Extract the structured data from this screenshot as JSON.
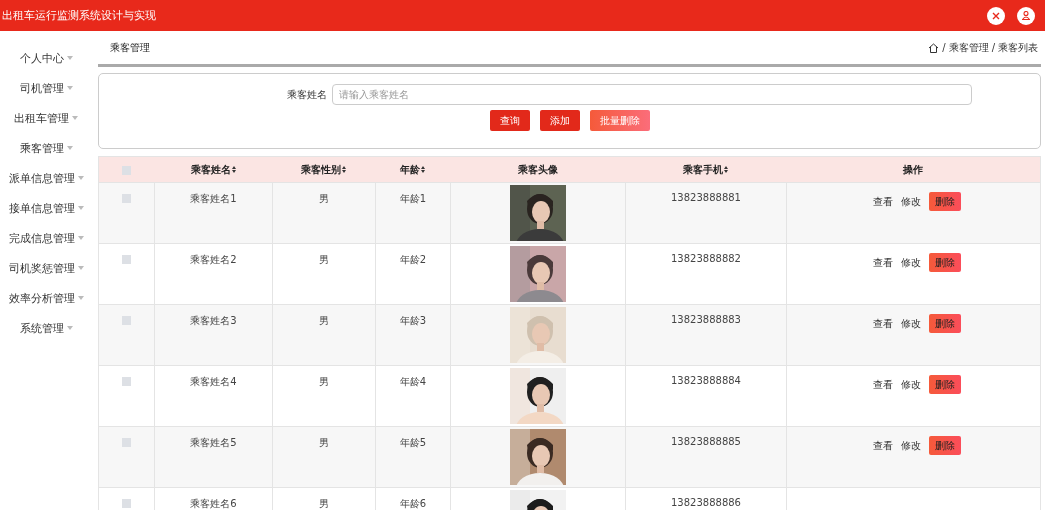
{
  "header": {
    "title": "出租车运行监测系统设计与实现"
  },
  "sidebar": {
    "items": [
      {
        "label": "个人中心"
      },
      {
        "label": "司机管理"
      },
      {
        "label": "出租车管理"
      },
      {
        "label": "乘客管理"
      },
      {
        "label": "派单信息管理"
      },
      {
        "label": "接单信息管理"
      },
      {
        "label": "完成信息管理"
      },
      {
        "label": "司机奖惩管理"
      },
      {
        "label": "效率分析管理"
      },
      {
        "label": "系统管理"
      }
    ]
  },
  "page_title": "乘客管理",
  "breadcrumb": [
    {
      "separator": "/",
      "label": "乘客管理"
    },
    {
      "separator": "/",
      "label": "乘客列表"
    }
  ],
  "search": {
    "label": "乘客姓名",
    "placeholder": "请输入乘客姓名",
    "buttons": [
      {
        "label": "查询",
        "kind": "primary"
      },
      {
        "label": "添加",
        "kind": "primary"
      },
      {
        "label": "批量删除",
        "kind": "danger"
      }
    ]
  },
  "table": {
    "select_all": {
      "checked": false
    },
    "columns": [
      {
        "label": "乘客姓名",
        "sortable": true
      },
      {
        "label": "乘客性别",
        "sortable": true
      },
      {
        "label": "年龄",
        "sortable": true
      },
      {
        "label": "乘客头像",
        "sortable": false
      },
      {
        "label": "乘客手机",
        "sortable": true
      },
      {
        "label": "操作",
        "sortable": false
      }
    ],
    "rows": [
      {
        "checked": false,
        "name": "乘客姓名1",
        "gender": "男",
        "age": "年龄1",
        "phone": "13823888881",
        "actions": [
          "查看",
          "修改",
          "删除"
        ]
      },
      {
        "checked": false,
        "name": "乘客姓名2",
        "gender": "男",
        "age": "年龄2",
        "phone": "13823888882",
        "actions": [
          "查看",
          "修改",
          "删除"
        ]
      },
      {
        "checked": false,
        "name": "乘客姓名3",
        "gender": "男",
        "age": "年龄3",
        "phone": "13823888883",
        "actions": [
          "查看",
          "修改",
          "删除"
        ]
      },
      {
        "checked": false,
        "name": "乘客姓名4",
        "gender": "男",
        "age": "年龄4",
        "phone": "13823888884",
        "actions": [
          "查看",
          "修改",
          "删除"
        ]
      },
      {
        "checked": false,
        "name": "乘客姓名5",
        "gender": "男",
        "age": "年龄5",
        "phone": "13823888885",
        "actions": [
          "查看",
          "修改",
          "删除"
        ]
      },
      {
        "checked": false,
        "name": "乘客姓名6",
        "gender": "男",
        "age": "年龄6",
        "phone": "13823888886"
      }
    ]
  }
}
